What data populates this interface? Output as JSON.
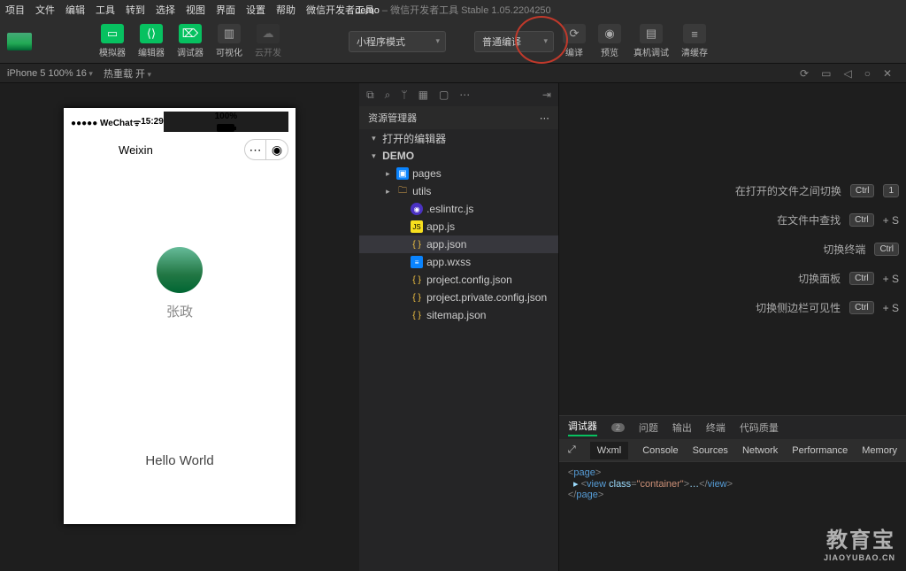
{
  "title": {
    "project": "demo",
    "app": "微信开发者工具 Stable 1.05.2204250"
  },
  "menus": [
    "项目",
    "文件",
    "编辑",
    "工具",
    "转到",
    "选择",
    "视图",
    "界面",
    "设置",
    "帮助",
    "微信开发者工具"
  ],
  "toolbar": {
    "simulator": "模拟器",
    "editor": "编辑器",
    "debugger": "调试器",
    "visual": "可视化",
    "cloud": "云开发",
    "mode": "小程序模式",
    "compile_mode": "普通编译",
    "compile": "编译",
    "preview": "预览",
    "remote": "真机调试",
    "clear": "清缓存"
  },
  "infobar": {
    "device": "iPhone 5 100% 16",
    "hot": "热重载 开"
  },
  "explorer": {
    "title": "资源管理器",
    "open_editors": "打开的编辑器",
    "root": "DEMO",
    "folders": {
      "pages": "pages",
      "utils": "utils"
    },
    "files": {
      "eslint": ".eslintrc.js",
      "appjs": "app.js",
      "appjson": "app.json",
      "appwxss": "app.wxss",
      "proj": "project.config.json",
      "projpriv": "project.private.config.json",
      "sitemap": "sitemap.json"
    }
  },
  "phone": {
    "carrier": "●●●●● WeChat",
    "wifi": "ᯤ",
    "time": "15:29",
    "battery": "100%",
    "title": "Weixin",
    "nick": "张政",
    "hello": "Hello World"
  },
  "commands": {
    "switch_file": "在打开的文件之间切换",
    "k1a": "Ctrl",
    "k1b": "1",
    "find": "在文件中查找",
    "k2a": "Ctrl",
    "k2b": "+ S",
    "terminal": "切换终端",
    "k3a": "Ctrl",
    "panel": "切换面板",
    "k4a": "Ctrl",
    "k4b": "+ S",
    "sidebar": "切换侧边栏可见性",
    "k5a": "Ctrl",
    "k5b": "+ S"
  },
  "devtools": {
    "tabs1": {
      "debugger": "调试器",
      "badge": "2",
      "problems": "问题",
      "output": "输出",
      "terminal": "终端",
      "quality": "代码质量"
    },
    "tabs2": {
      "wxml": "Wxml",
      "console": "Console",
      "sources": "Sources",
      "network": "Network",
      "performance": "Performance",
      "memory": "Memory"
    },
    "code": {
      "open_page": "page",
      "view": "view",
      "class_attr": "class",
      "class_val": "container",
      "close_page": "page"
    }
  },
  "watermark": {
    "big": "教育宝",
    "small": "JIAOYUBAO.CN"
  }
}
